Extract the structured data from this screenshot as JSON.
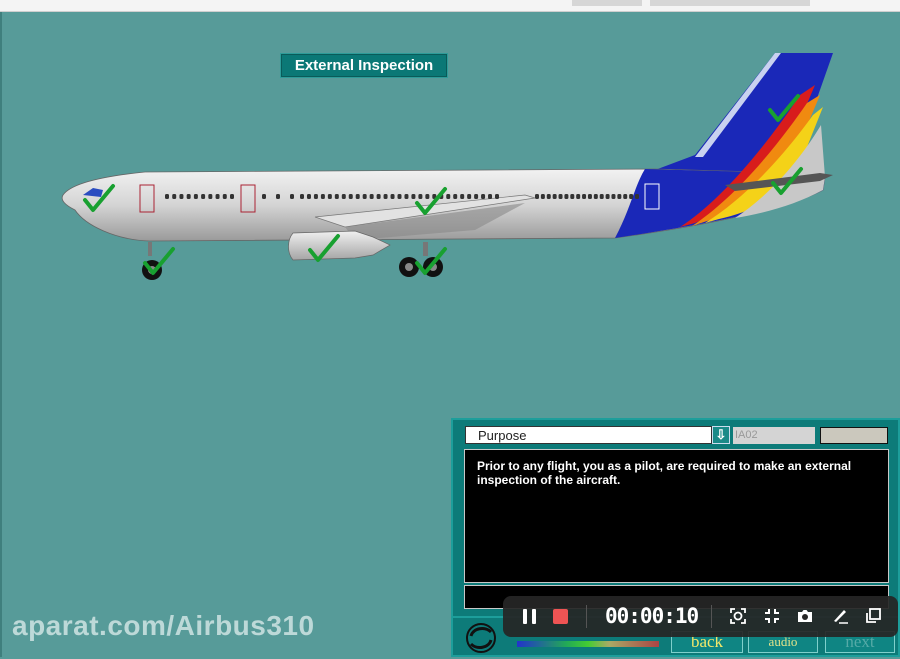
{
  "screen": {
    "title": "External Inspection"
  },
  "aircraft": {
    "livery_colors": {
      "fuselage": "#d8d8d8",
      "tail_blue": "#1a28b8",
      "stripe_red": "#d81c1c",
      "stripe_orange": "#f08a10",
      "stripe_yellow": "#f4d218"
    },
    "checkpoints": [
      {
        "name": "cockpit-nose",
        "checked": true
      },
      {
        "name": "nose-gear",
        "checked": true
      },
      {
        "name": "engine",
        "checked": true
      },
      {
        "name": "wing",
        "checked": true
      },
      {
        "name": "main-gear",
        "checked": true
      },
      {
        "name": "vertical-stabilizer",
        "checked": true
      },
      {
        "name": "horizontal-stabilizer",
        "checked": true
      }
    ]
  },
  "panel": {
    "topic_select": {
      "value": "Purpose"
    },
    "code": "IA02",
    "description": "Prior to any flight, you as a pilot, are required to make an external inspection of the aircraft.",
    "nav": {
      "back": "back",
      "audio": "audio",
      "next": "next"
    }
  },
  "recorder": {
    "time": "00:00:10",
    "controls": [
      "pause",
      "stop",
      "screenshot-region",
      "shrink",
      "camera",
      "annotate",
      "pip"
    ]
  },
  "watermark": "aparat.com/Airbus310"
}
